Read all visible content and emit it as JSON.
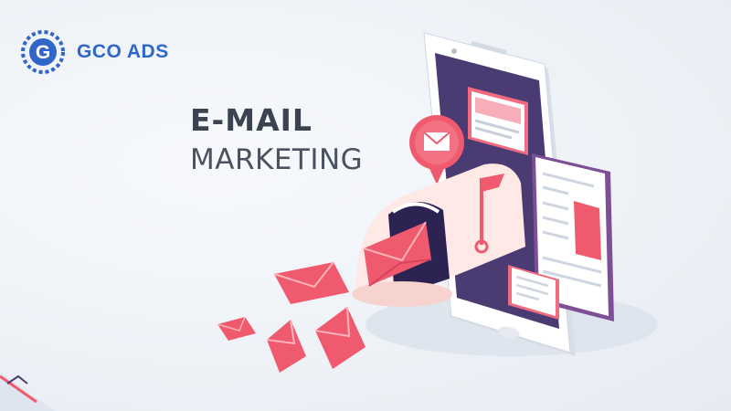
{
  "brand": {
    "name": "GCO ADS",
    "logo_letter": "G",
    "colors": {
      "primary": "#2f66c7",
      "light": "#5fa0e8"
    }
  },
  "headline": {
    "line1": "E-MAIL",
    "line2": "MARKETING"
  },
  "illustration": {
    "colors": {
      "phone_body": "#ffffff",
      "phone_screen": "#4b3b73",
      "accent": "#f05a6e",
      "accent_dark": "#d9435a",
      "panel": "#7c4f97",
      "mailbox": "#ffe9e6"
    },
    "icons": [
      "smartphone-icon",
      "mailbox-icon",
      "envelope-icon",
      "document-icon",
      "chat-bubble-icon"
    ]
  }
}
